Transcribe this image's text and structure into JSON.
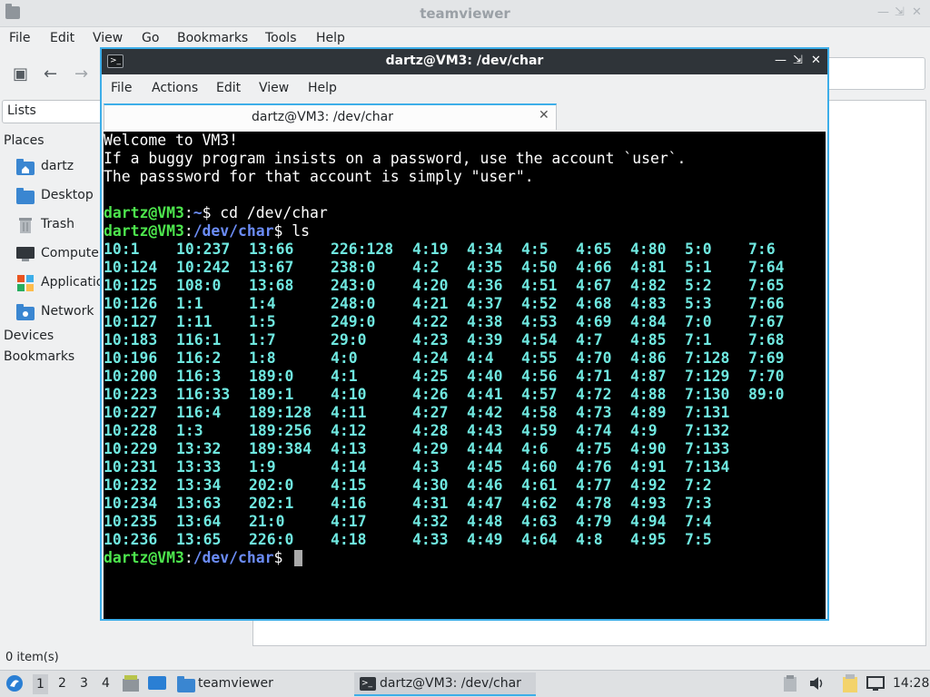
{
  "file_manager": {
    "title": "teamviewer",
    "menu": [
      "File",
      "Edit",
      "View",
      "Go",
      "Bookmarks",
      "Tools",
      "Help"
    ],
    "side_select": "Lists",
    "places_heading": "Places",
    "places": [
      "dartz",
      "Desktop",
      "Trash",
      "Computer",
      "Applications",
      "Network"
    ],
    "devices_heading": "Devices",
    "bookmarks_heading": "Bookmarks",
    "status": "0 item(s)"
  },
  "terminal": {
    "title": "dartz@VM3: /dev/char",
    "menu": [
      "File",
      "Actions",
      "Edit",
      "View",
      "Help"
    ],
    "tab_label": "dartz@VM3: /dev/char",
    "welcome": [
      "Welcome to VM3!",
      "If a buggy program insists on a password, use the account `user`.",
      "The passsword for that account is simply \"user\"."
    ],
    "prompt1": {
      "user": "dartz@VM3",
      "sep": ":",
      "path": "~",
      "dollar": "$",
      "cmd": " cd /dev/char"
    },
    "prompt2": {
      "user": "dartz@VM3",
      "sep": ":",
      "path": "/dev/char",
      "dollar": "$",
      "cmd": " ls"
    },
    "prompt3": {
      "user": "dartz@VM3",
      "sep": ":",
      "path": "/dev/char",
      "dollar": "$",
      "cmd": " "
    },
    "ls_columns": [
      [
        "10:1",
        "10:124",
        "10:125",
        "10:126",
        "10:127",
        "10:183",
        "10:196",
        "10:200",
        "10:223",
        "10:227",
        "10:228",
        "10:229",
        "10:231",
        "10:232",
        "10:234",
        "10:235",
        "10:236"
      ],
      [
        "10:237",
        "10:242",
        "108:0",
        "1:1",
        "1:11",
        "116:1",
        "116:2",
        "116:3",
        "116:33",
        "116:4",
        "1:3",
        "13:32",
        "13:33",
        "13:34",
        "13:63",
        "13:64",
        "13:65"
      ],
      [
        "13:66",
        "13:67",
        "13:68",
        "1:4",
        "1:5",
        "1:7",
        "1:8",
        "189:0",
        "189:1",
        "189:128",
        "189:256",
        "189:384",
        "1:9",
        "202:0",
        "202:1",
        "21:0",
        "226:0"
      ],
      [
        "226:128",
        "238:0",
        "243:0",
        "248:0",
        "249:0",
        "29:0",
        "4:0",
        "4:1",
        "4:10",
        "4:11",
        "4:12",
        "4:13",
        "4:14",
        "4:15",
        "4:16",
        "4:17",
        "4:18"
      ],
      [
        "4:19",
        "4:2",
        "4:20",
        "4:21",
        "4:22",
        "4:23",
        "4:24",
        "4:25",
        "4:26",
        "4:27",
        "4:28",
        "4:29",
        "4:3",
        "4:30",
        "4:31",
        "4:32",
        "4:33"
      ],
      [
        "4:34",
        "4:35",
        "4:36",
        "4:37",
        "4:38",
        "4:39",
        "4:4",
        "4:40",
        "4:41",
        "4:42",
        "4:43",
        "4:44",
        "4:45",
        "4:46",
        "4:47",
        "4:48",
        "4:49"
      ],
      [
        "4:5",
        "4:50",
        "4:51",
        "4:52",
        "4:53",
        "4:54",
        "4:55",
        "4:56",
        "4:57",
        "4:58",
        "4:59",
        "4:6",
        "4:60",
        "4:61",
        "4:62",
        "4:63",
        "4:64"
      ],
      [
        "4:65",
        "4:66",
        "4:67",
        "4:68",
        "4:69",
        "4:7",
        "4:70",
        "4:71",
        "4:72",
        "4:73",
        "4:74",
        "4:75",
        "4:76",
        "4:77",
        "4:78",
        "4:79",
        "4:8"
      ],
      [
        "4:80",
        "4:81",
        "4:82",
        "4:83",
        "4:84",
        "4:85",
        "4:86",
        "4:87",
        "4:88",
        "4:89",
        "4:9",
        "4:90",
        "4:91",
        "4:92",
        "4:93",
        "4:94",
        "4:95"
      ],
      [
        "5:0",
        "5:1",
        "5:2",
        "5:3",
        "7:0",
        "7:1",
        "7:128",
        "7:129",
        "7:130",
        "7:131",
        "7:132",
        "7:133",
        "7:134",
        "7:2",
        "7:3",
        "7:4",
        "7:5"
      ],
      [
        "7:6",
        "7:64",
        "7:65",
        "7:66",
        "7:67",
        "7:68",
        "7:69",
        "7:70",
        "89:0"
      ]
    ]
  },
  "taskbar": {
    "workspaces": [
      "1",
      "2",
      "3",
      "4"
    ],
    "tasks": [
      "teamviewer",
      "dartz@VM3: /dev/char"
    ],
    "clock": "14:28"
  },
  "colors": {
    "accent": "#3daee9",
    "prompt_user": "#4de64d",
    "prompt_path": "#6b8cf5",
    "ls_entry": "#6fe8e0"
  }
}
